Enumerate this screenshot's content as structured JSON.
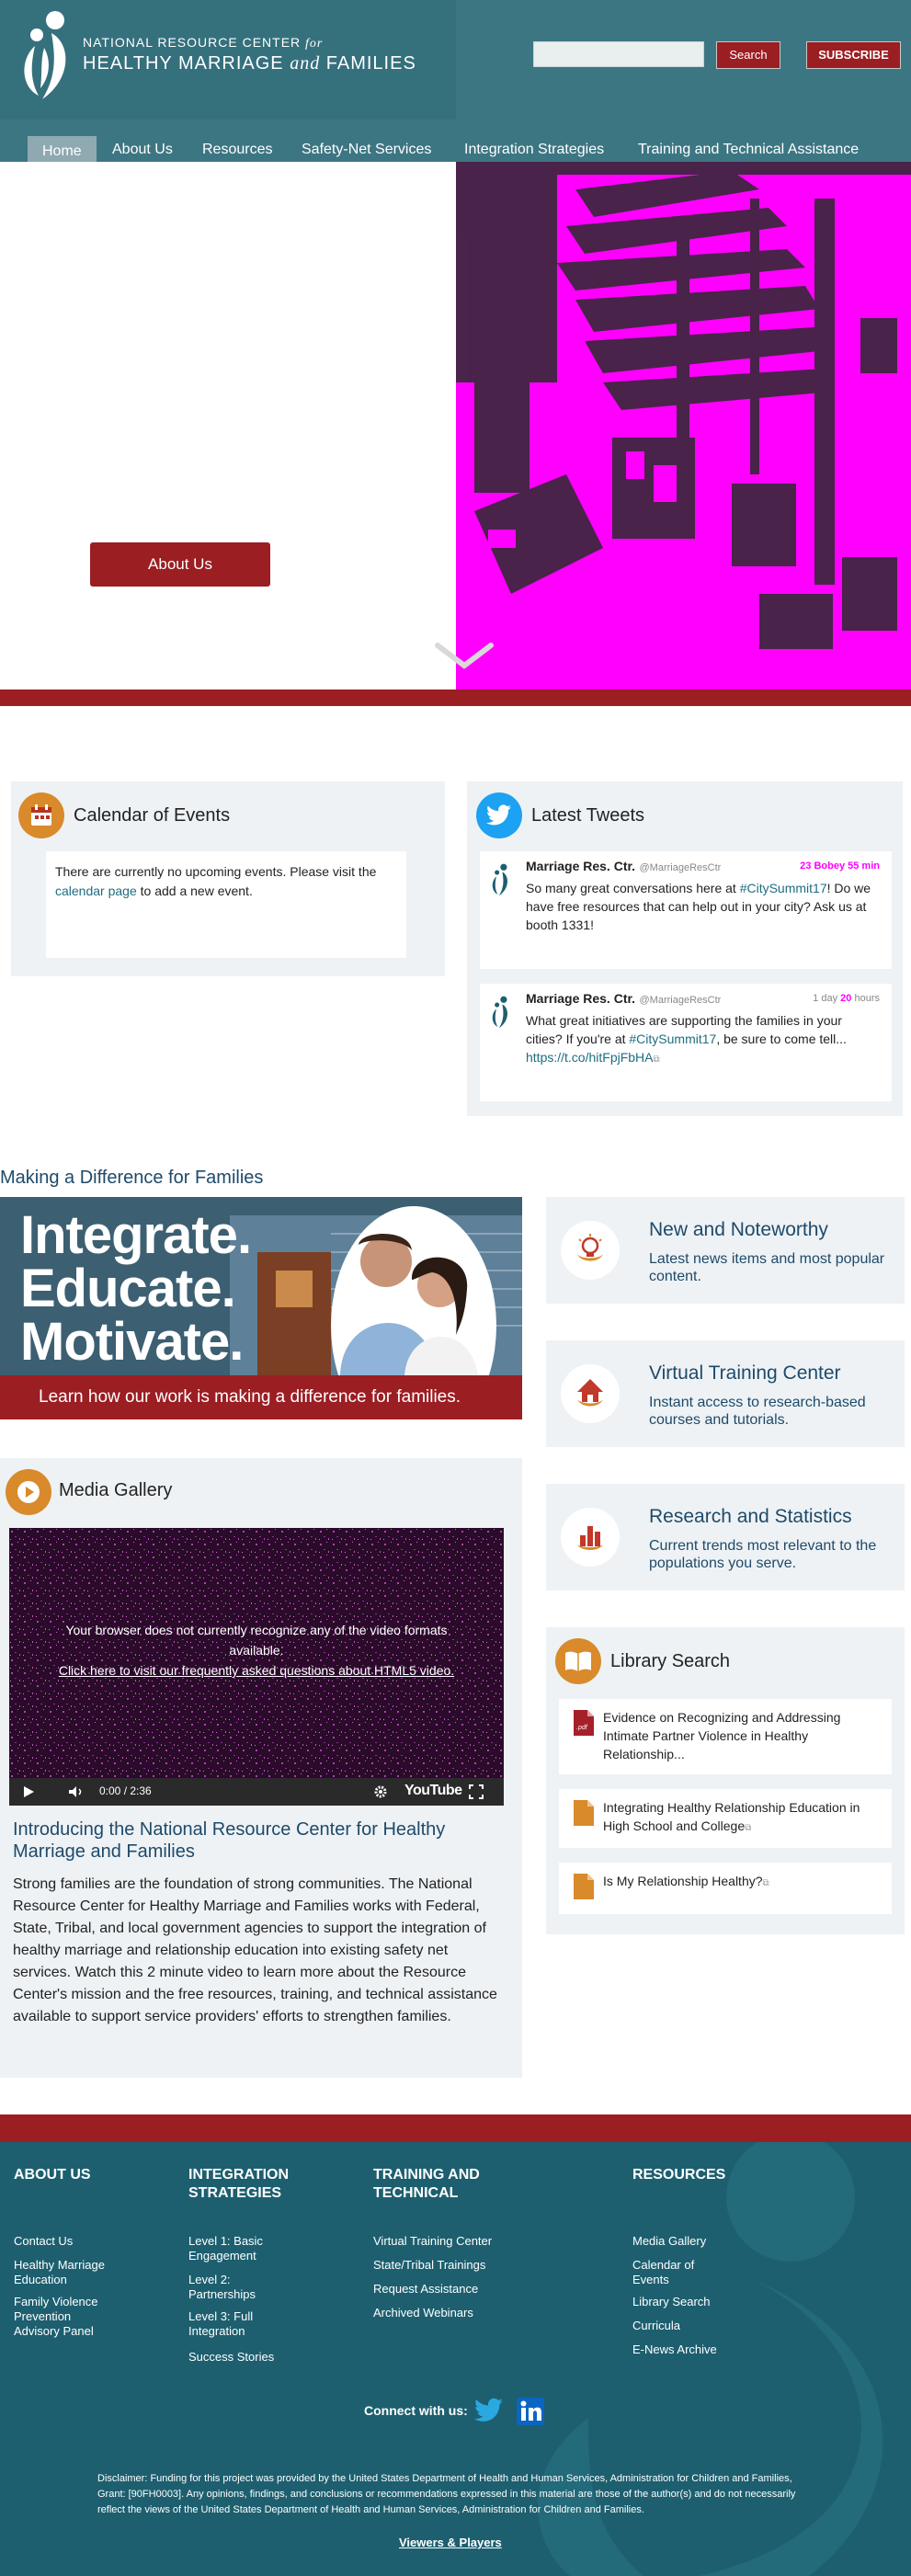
{
  "header": {
    "logo_line1": "NATIONAL RESOURCE CENTER",
    "logo_for": "for",
    "logo_line2a": "HEALTHY MARRIAGE",
    "logo_and": "and",
    "logo_line2b": "FAMILIES",
    "search_placeholder": "",
    "search_label": "Search",
    "subscribe_label": "SUBSCRIBE"
  },
  "nav": {
    "items": [
      "Home",
      "About Us",
      "Resources",
      "Safety-Net Services",
      "Integration Strategies",
      "Training and Technical Assistance"
    ]
  },
  "hero": {
    "button_label": "About Us"
  },
  "calendar": {
    "title": "Calendar of Events",
    "text_before": "There are currently no upcoming events. Please visit the ",
    "link": "calendar page",
    "text_after": " to add a new event."
  },
  "tweets": {
    "title": "Latest Tweets",
    "items": [
      {
        "name": "Marriage Res. Ctr.",
        "handle": "@MarriageResCtr",
        "time": "23 Bobey 55 min",
        "body_before": "So many great conversations here at ",
        "hashtag": "#CitySummit17",
        "body_after": "! Do we have free resources that can help out in your city? Ask us at booth 1331!"
      },
      {
        "name": "Marriage Res. Ctr.",
        "handle": "@MarriageResCtr",
        "time_prefix": "1 day",
        "time_mid": "20",
        "time_suffix": "hours",
        "body_before": "What great initiatives are supporting the families in your cities? If you're at ",
        "hashtag": "#CitySummit17",
        "body_after": ", be sure to come tell...",
        "link": "https://t.co/hitFpjFbHA"
      }
    ]
  },
  "difference": {
    "title": "Making a Difference for Families",
    "banner_words": [
      "Integrate.",
      "Educate.",
      "Motivate."
    ],
    "banner_strip": "Learn how our work is making a difference for families."
  },
  "features": [
    {
      "title": "New and Noteworthy",
      "desc": "Latest news items and most popular content.",
      "icon": "lightbulb-icon"
    },
    {
      "title": "Virtual Training Center",
      "desc": "Instant access to research-based courses and tutorials.",
      "icon": "house-icon"
    },
    {
      "title": "Research and Statistics",
      "desc": "Current trends most relevant to the populations you serve.",
      "icon": "bar-chart-icon"
    }
  ],
  "media": {
    "title": "Media Gallery",
    "video_msg": "Your browser does not currently recognize any of the video formats available.",
    "video_link": "Click here to visit our frequently asked questions about HTML5 video.",
    "time": "0:00 / 2:36",
    "youtube": "YouTube",
    "heading": "Introducing the National Resource Center for Healthy Marriage and Families",
    "body": "Strong families are the foundation of strong communities. The National Resource Center for Healthy Marriage and Families works with Federal, State, Tribal, and local government agencies to support the integration of healthy marriage and relationship education into existing safety net services. Watch this 2 minute video to learn more about the Resource Center's mission and the free resources, training, and technical assistance available to support service providers' efforts to strengthen families."
  },
  "library": {
    "title": "Library Search",
    "items": [
      "Evidence on Recognizing and Addressing Intimate Partner Violence in Healthy Relationship...",
      "Integrating Healthy Relationship Education in High School and College",
      "Is My Relationship Healthy?"
    ]
  },
  "footer": {
    "columns": [
      {
        "head": "ABOUT US",
        "links": [
          "Contact Us",
          "Healthy Marriage Education",
          "Family Violence Prevention Advisory Panel"
        ]
      },
      {
        "head": "INTEGRATION STRATEGIES",
        "links": [
          "Level 1: Basic Engagement",
          "Level 2: Partnerships",
          "Level 3: Full Integration",
          "Success Stories"
        ]
      },
      {
        "head": "TRAINING AND TECHNICAL",
        "links": [
          "Virtual Training Center",
          "State/Tribal Trainings",
          "Request Assistance",
          "Archived Webinars"
        ]
      },
      {
        "head": "RESOURCES",
        "links": [
          "Media Gallery",
          "Calendar of Events",
          "Library Search",
          "Curricula",
          "E-News Archive"
        ]
      }
    ],
    "connect": "Connect with us:",
    "disclaimer": "Disclaimer: Funding for this project was provided by the United States Department of Health and Human Services, Administration for Children and Families, Grant: [90FH0003]. Any opinions, findings, and conclusions or recommendations expressed in this material are those of the author(s) and do not necessarily reflect the views of the United States Department of Health and Human Services, Administration for Children and Families.",
    "viewers": "Viewers & Players"
  },
  "colors": {
    "teal": "#3d7683",
    "red": "#9b1e23",
    "orange": "#d98a2b",
    "magenta": "#ff00ff"
  }
}
